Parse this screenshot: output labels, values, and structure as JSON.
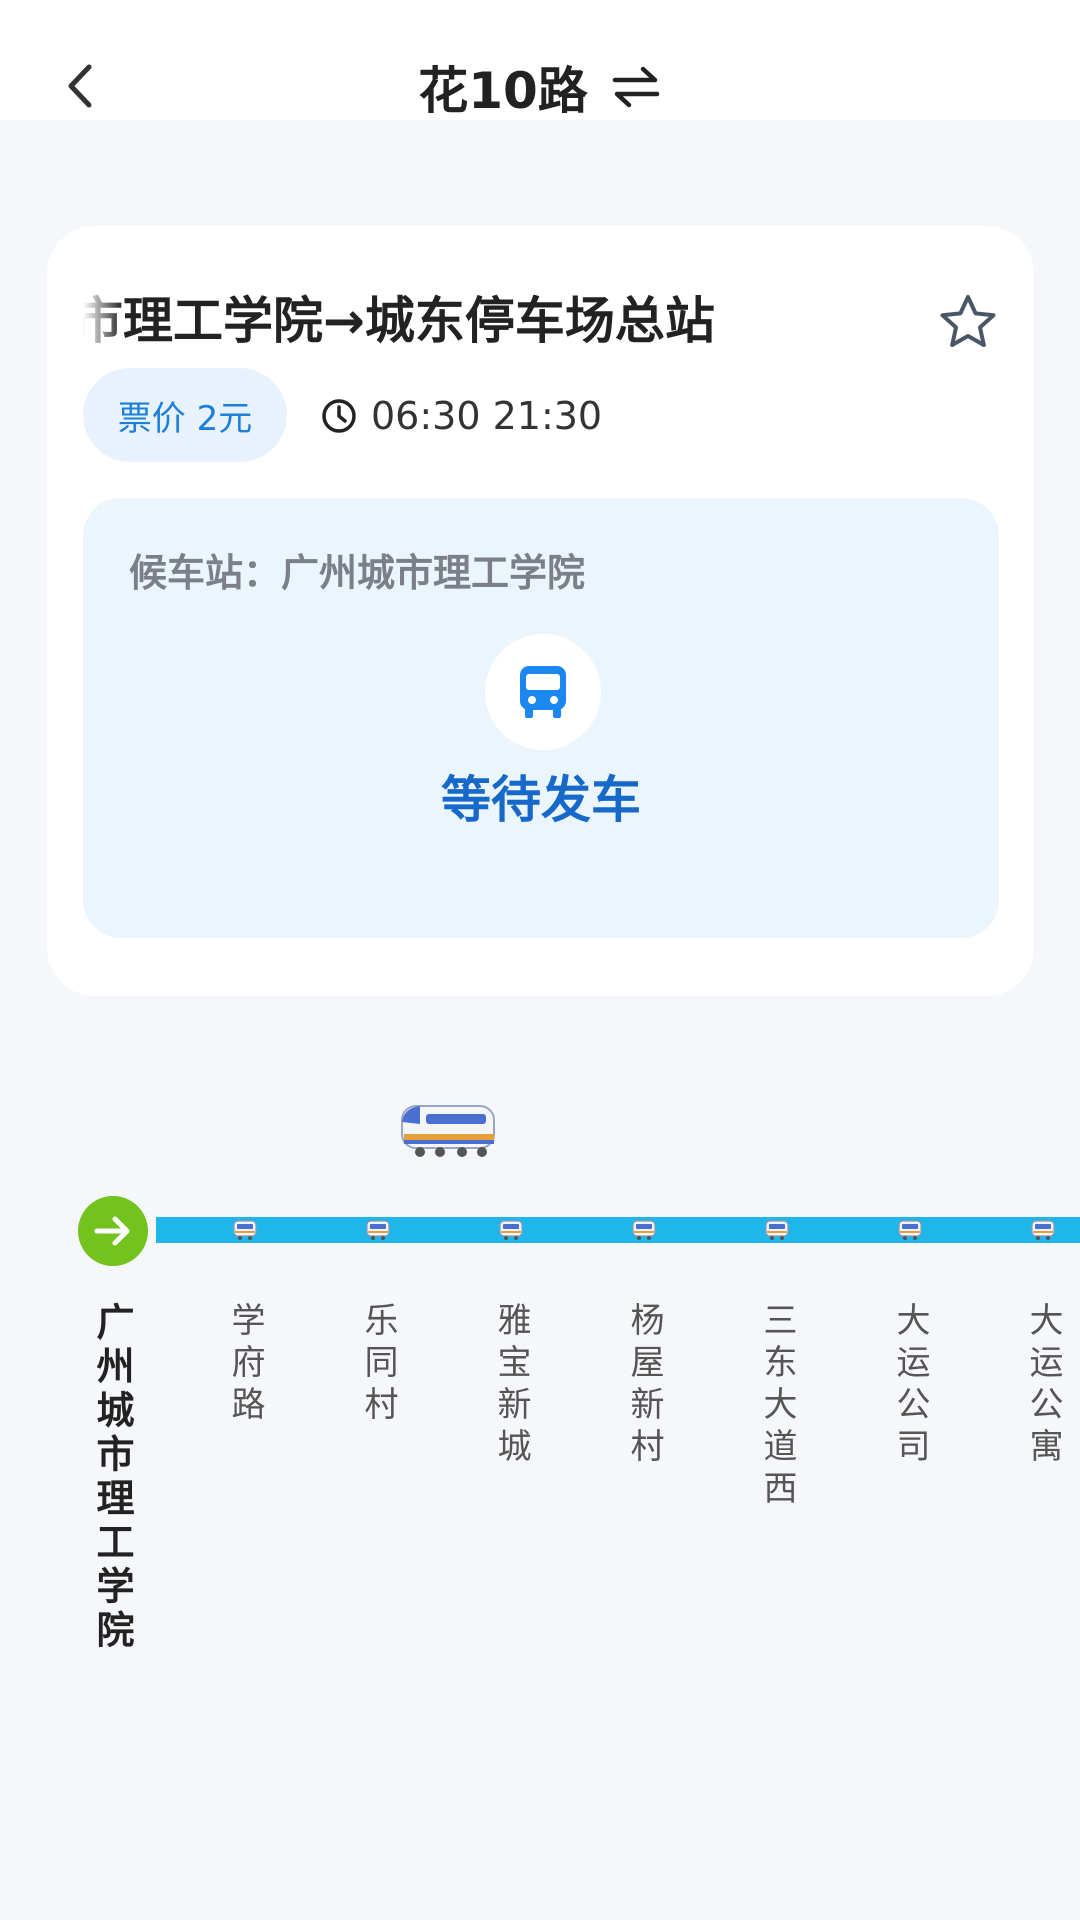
{
  "header": {
    "route_name": "花10路"
  },
  "card": {
    "direction": "市理工学院→城东停车场总站",
    "fare": "票价 2元",
    "hours": "06:30 21:30",
    "waiting_station": "候车站：广州城市理工学院",
    "status": "等待发车"
  },
  "stations": [
    "广州城市理工学院",
    "学府路",
    "乐同村",
    "雅宝新城",
    "杨屋新村",
    "三东大道西",
    "大运公司",
    "大运公寓"
  ],
  "colors": {
    "accent_blue": "#1668c9",
    "track_cyan": "#1fb6e9",
    "start_green": "#72c31d",
    "fare_text": "#1e7fd8"
  },
  "icons": {
    "back": "chevron-left-icon",
    "swap": "swap-direction-icon",
    "favorite": "star-outline-icon",
    "clock": "clock-icon",
    "bus": "bus-icon",
    "start": "arrow-right-icon",
    "vehicle": "train-icon"
  }
}
